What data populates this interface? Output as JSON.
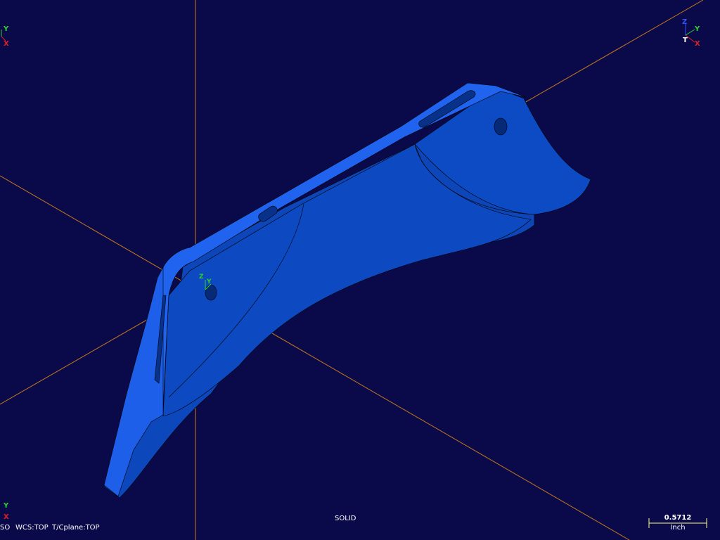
{
  "viewport": {
    "background": "#0a0a4a",
    "axis_color": "#c87a1a",
    "part_color": "#1155cc",
    "part_highlight": "#2a6bf0"
  },
  "triads": {
    "top_left": {
      "y": "Y",
      "x": "X"
    },
    "top_right": {
      "z": "Z",
      "y": "Y",
      "t": "T",
      "x": "X"
    },
    "part": {
      "z": "Z",
      "y": "Y"
    },
    "bottom_left": {
      "y": "Y",
      "x": "X"
    }
  },
  "status_bar": {
    "view": "SO",
    "wcs": "WCS:TOP",
    "tcplane": "T/Cplane:TOP",
    "mode": "SOLID"
  },
  "scale": {
    "value": "0.5712",
    "unit": "Inch"
  }
}
